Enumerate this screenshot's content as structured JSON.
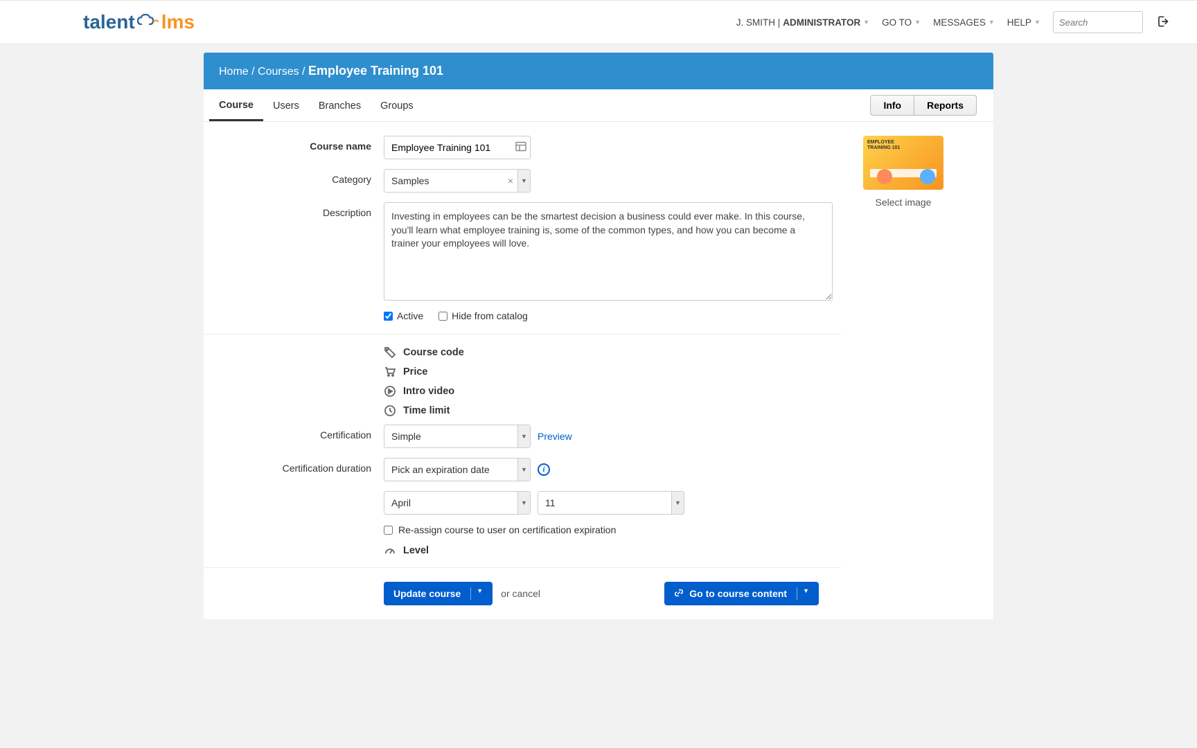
{
  "header": {
    "logo_talent": "talent",
    "logo_lms": "lms",
    "user_prefix": "J. SMITH |",
    "user_role": "ADMINISTRATOR",
    "nav": {
      "goto": "GO TO",
      "messages": "MESSAGES",
      "help": "HELP"
    },
    "search_placeholder": "Search"
  },
  "breadcrumb": {
    "home": "Home",
    "courses": "Courses",
    "current": "Employee Training 101"
  },
  "tabs": {
    "course": "Course",
    "users": "Users",
    "branches": "Branches",
    "groups": "Groups"
  },
  "tabbar_right": {
    "info": "Info",
    "reports": "Reports"
  },
  "form": {
    "course_name_label": "Course name",
    "course_name_value": "Employee Training 101",
    "category_label": "Category",
    "category_value": "Samples",
    "description_label": "Description",
    "description_value": "Investing in employees can be the smartest decision a business could ever make. In this course, you'll learn what employee training is, some of the common types, and how you can become a trainer your employees will love.",
    "active": "Active",
    "hide": "Hide from catalog",
    "options": {
      "course_code": "Course code",
      "price": "Price",
      "intro_video": "Intro video",
      "time_limit": "Time limit"
    },
    "certification_label": "Certification",
    "certification_value": "Simple",
    "preview": "Preview",
    "cert_duration_label": "Certification duration",
    "cert_duration_value": "Pick an expiration date",
    "month": "April",
    "day": "11",
    "reassign": "Re-assign course to user on certification expiration",
    "level": "Level"
  },
  "side": {
    "thumb_line1": "EMPLOYEE",
    "thumb_line2": "TRAINING 101",
    "select_image": "Select image"
  },
  "footer": {
    "update": "Update course",
    "cancel_or": "or",
    "cancel": "cancel",
    "goto_content": "Go to course content"
  }
}
